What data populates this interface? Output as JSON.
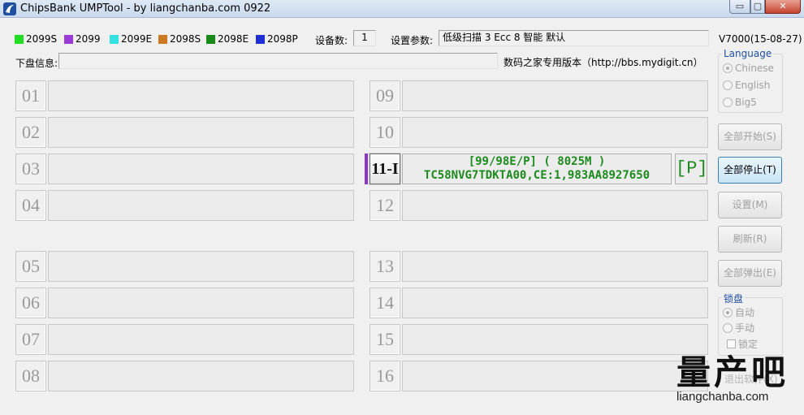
{
  "window": {
    "title": "ChipsBank UMPTool - by liangchanba.com 0922",
    "min": "▭",
    "max": "▢",
    "close": "✕"
  },
  "legend": [
    {
      "label": "2099S",
      "color": "#22dd22"
    },
    {
      "label": "2099",
      "color": "#9b3bd6"
    },
    {
      "label": "2099E",
      "color": "#33e1e1"
    },
    {
      "label": "2098S",
      "color": "#cc7a22"
    },
    {
      "label": "2098E",
      "color": "#188a18"
    },
    {
      "label": "2098P",
      "color": "#1f2fd6"
    }
  ],
  "device_count": {
    "label": "设备数:",
    "value": "1"
  },
  "settings_param": {
    "label": "设置参数:",
    "value": "低级扫描 3 Ecc 8 智能 默认"
  },
  "version": "V7000(15-08-27)",
  "disk_info": {
    "label": "下盘信息:",
    "value": ""
  },
  "forum_note": "数码之家专用版本（http://bbs.mydigit.cn）",
  "slots": [
    {
      "num": "01"
    },
    {
      "num": "02"
    },
    {
      "num": "03"
    },
    {
      "num": "04"
    },
    {
      "num": "05"
    },
    {
      "num": "06"
    },
    {
      "num": "07"
    },
    {
      "num": "08"
    },
    {
      "num": "09"
    },
    {
      "num": "10"
    },
    {
      "num": "11-I",
      "line1": "[99/98E/P] ( 8025M )",
      "line2": "TC58NVG7TDKTA00,CE:1,983AA8927650",
      "badge": "[P]"
    },
    {
      "num": "12"
    },
    {
      "num": "13"
    },
    {
      "num": "14"
    },
    {
      "num": "15"
    },
    {
      "num": "16"
    }
  ],
  "language": {
    "title": "Language",
    "options": [
      "Chinese",
      "English",
      "Big5"
    ],
    "selected": "Chinese"
  },
  "buttons": {
    "start_all": "全部开始(S)",
    "stop_all": "全部停止(T)",
    "settings": "设置(M)",
    "refresh": "刷新(R)",
    "eject_all": "全部弹出(E)"
  },
  "lock": {
    "title": "锁盘",
    "options": [
      "自动",
      "手动"
    ],
    "selected": "自动",
    "checkbox": "锁定"
  },
  "exit_label": "退出软件(X)",
  "watermark": {
    "big": "量产吧",
    "small": "liangchanba.com"
  }
}
